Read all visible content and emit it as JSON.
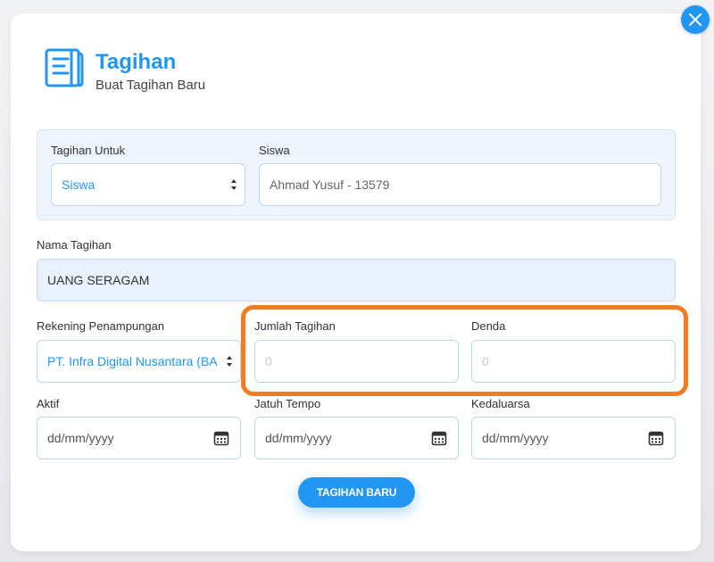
{
  "header": {
    "title": "Tagihan",
    "subtitle": "Buat Tagihan Baru",
    "icon": "document-list-icon"
  },
  "close": {
    "icon": "close-icon"
  },
  "form": {
    "tagihan_untuk": {
      "label": "Tagihan Untuk",
      "value": "Siswa"
    },
    "siswa": {
      "label": "Siswa",
      "value": "Ahmad Yusuf - 13579"
    },
    "nama_tagihan": {
      "label": "Nama Tagihan",
      "value": "UANG SERAGAM"
    },
    "rekening": {
      "label": "Rekening Penampungan",
      "value": "PT. Infra Digital Nusantara (BA"
    },
    "jumlah": {
      "label": "Jumlah Tagihan",
      "placeholder": "0"
    },
    "denda": {
      "label": "Denda",
      "placeholder": "0"
    },
    "aktif": {
      "label": "Aktif",
      "value": "dd/mm/yyyy"
    },
    "jatuh_tempo": {
      "label": "Jatuh Tempo",
      "value": "dd/mm/yyyy"
    },
    "kedaluarsa": {
      "label": "Kedaluarsa",
      "value": "dd/mm/yyyy"
    }
  },
  "submit": {
    "label": "TAGIHAN BARU"
  },
  "colors": {
    "accent": "#2196f3",
    "highlight": "#f47b20"
  }
}
